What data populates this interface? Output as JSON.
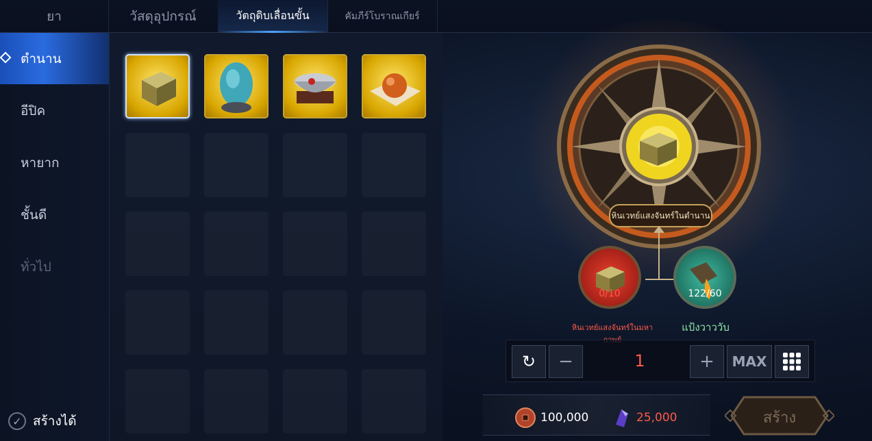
{
  "tabs": [
    {
      "label": "ยา"
    },
    {
      "label": "วัสดุอุปกรณ์"
    },
    {
      "label": "วัตถุดิบเลื่อนขั้น"
    },
    {
      "label": "คัมภีร์โบราณเกียร์"
    }
  ],
  "categories": [
    {
      "label": "ตำนาน"
    },
    {
      "label": "อีปิค"
    },
    {
      "label": "หายาก"
    },
    {
      "label": "ชั้นดี"
    },
    {
      "label": "ทั่วไป"
    }
  ],
  "can_make_label": "สร้างได้",
  "items": [
    {
      "icon": "gold-stone-cube-icon"
    },
    {
      "icon": "blue-egg-icon"
    },
    {
      "icon": "silver-bowl-icon"
    },
    {
      "icon": "orange-orb-icon"
    }
  ],
  "craft": {
    "result_name": "หินเวทย์แสงจันทร์ในตำนาน",
    "ingredients": [
      {
        "name": "หินเวทย์แสงจันทร์ในมหากาพย์",
        "count": "0/10",
        "icon": "stone-cube-icon",
        "color": "#ff5a4a"
      },
      {
        "name": "แป้งวาววับ",
        "count": "122/60",
        "icon": "powder-scoop-icon",
        "color": "#8fe3a8"
      }
    ],
    "quantity": "1",
    "max_label": "MAX",
    "costs": [
      {
        "value": "100,000",
        "icon": "coin-icon",
        "color": "#ffffff"
      },
      {
        "value": "25,000",
        "icon": "crystal-icon",
        "color": "#ff5a4a"
      }
    ],
    "create_label": "สร้าง"
  }
}
